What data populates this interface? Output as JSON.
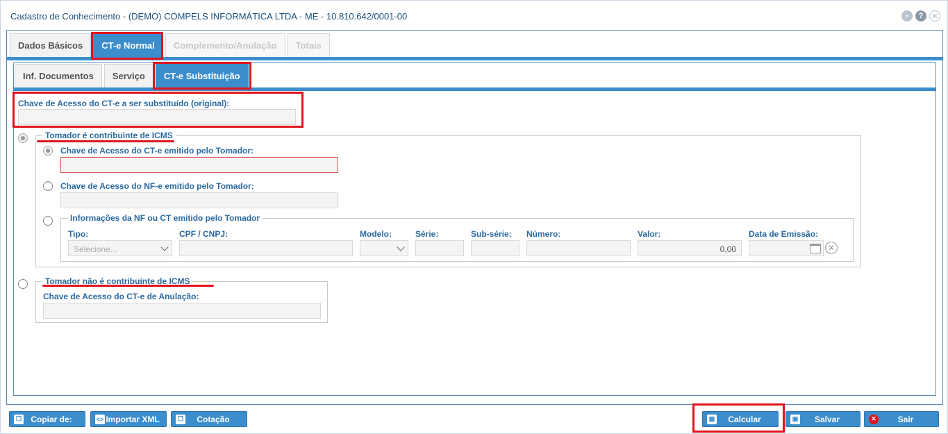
{
  "window": {
    "title": "Cadastro de Conhecimento - (DEMO) COMPELS INFORMÁTICA LTDA - ME - 10.810.642/0001-00"
  },
  "main_tabs": [
    {
      "label": "Dados Básicos"
    },
    {
      "label": "CT-e Normal"
    },
    {
      "label": "Complemento/Anulação"
    },
    {
      "label": "Totais"
    }
  ],
  "sub_tabs": [
    {
      "label": "Inf. Documentos"
    },
    {
      "label": "Serviço"
    },
    {
      "label": "CT-e Substituição"
    }
  ],
  "form": {
    "chave_original_label": "Chave de Acesso do CT-e a ser substituído (original):",
    "chave_original_value": "",
    "contribuinte_legend": "Tomador é contribuinte de ICMS",
    "cte_tomador_label": "Chave de Acesso do CT-e emitido pelo Tomador:",
    "nfe_tomador_label": "Chave de Acesso do NF-e emitido pelo Tomador:",
    "info_nf_legend": "Informações da NF ou CT emitido pelo Tomador",
    "cols": {
      "tipo": "Tipo:",
      "cpf": "CPF / CNPJ:",
      "modelo": "Modelo:",
      "serie": "Série:",
      "subserie": "Sub-série:",
      "numero": "Número:",
      "valor": "Valor:",
      "data": "Data de Emissão:"
    },
    "tipo_placeholder": "Selecione...",
    "valor_value": "0,00",
    "nao_contribuinte_legend": "Tomador não é contribuinte de ICMS",
    "cte_anulacao_label": "Chave de Acesso do CT-e de Anulação:"
  },
  "buttons": {
    "copiar": "Copiar de:",
    "importar": "Importar XML",
    "cotacao": "Cotação",
    "calcular": "Calcular",
    "salvar": "Salvar",
    "sair": "Sair"
  },
  "colors": {
    "accent": "#3c8dcc",
    "highlight": "#e0141d",
    "label": "#2b6aa0"
  }
}
